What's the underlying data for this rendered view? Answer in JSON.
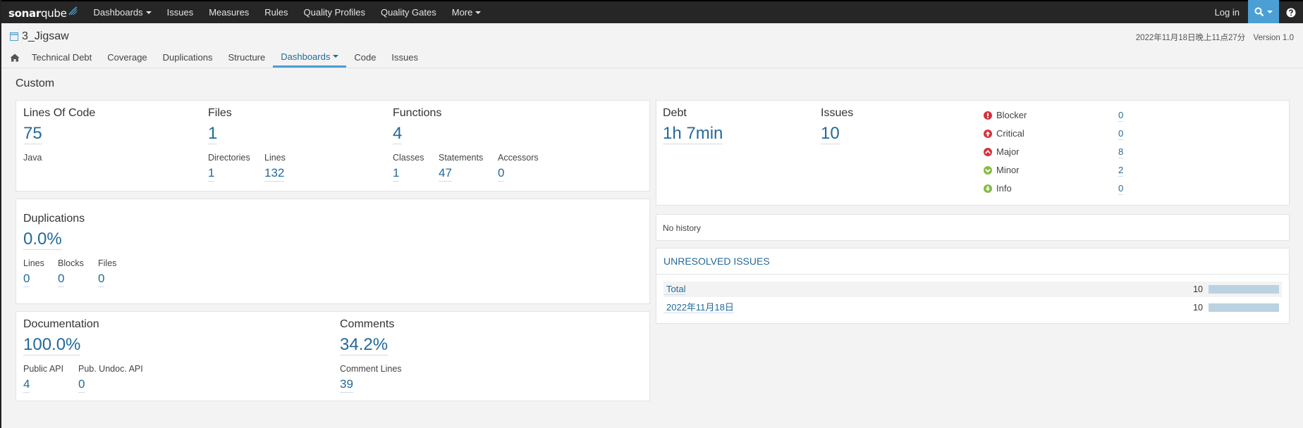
{
  "nav": {
    "logo_bold": "sonar",
    "logo_light": "qube",
    "items": [
      "Dashboards",
      "Issues",
      "Measures",
      "Rules",
      "Quality Profiles",
      "Quality Gates",
      "More"
    ],
    "login": "Log in"
  },
  "project": {
    "name": "3_Jigsaw",
    "date": "2022年11月18日晚上11点27分",
    "version": "Version 1.0"
  },
  "subnav": {
    "items": [
      "Technical Debt",
      "Coverage",
      "Duplications",
      "Structure",
      "Dashboards",
      "Code",
      "Issues"
    ],
    "active": "Dashboards"
  },
  "page_title": "Custom",
  "size": {
    "loc_label": "Lines Of Code",
    "loc_value": "75",
    "language": "Java",
    "files_label": "Files",
    "files_value": "1",
    "directories_label": "Directories",
    "directories_value": "1",
    "lines_label": "Lines",
    "lines_value": "132",
    "functions_label": "Functions",
    "functions_value": "4",
    "classes_label": "Classes",
    "classes_value": "1",
    "statements_label": "Statements",
    "statements_value": "47",
    "accessors_label": "Accessors",
    "accessors_value": "0"
  },
  "duplications": {
    "title": "Duplications",
    "value": "0.0%",
    "lines_label": "Lines",
    "lines_value": "0",
    "blocks_label": "Blocks",
    "blocks_value": "0",
    "files_label": "Files",
    "files_value": "0"
  },
  "documentation": {
    "title": "Documentation",
    "value": "100.0%",
    "public_api_label": "Public API",
    "public_api_value": "4",
    "undoc_label": "Pub. Undoc. API",
    "undoc_value": "0",
    "comments_title": "Comments",
    "comments_value": "34.2%",
    "comment_lines_label": "Comment Lines",
    "comment_lines_value": "39"
  },
  "debt": {
    "debt_label": "Debt",
    "debt_value": "1h 7min",
    "issues_label": "Issues",
    "issues_value": "10",
    "severities": [
      {
        "name": "Blocker",
        "count": "0",
        "color": "#d4333f"
      },
      {
        "name": "Critical",
        "count": "0",
        "color": "#d4333f"
      },
      {
        "name": "Major",
        "count": "8",
        "color": "#d4333f"
      },
      {
        "name": "Minor",
        "count": "2",
        "color": "#85bb43"
      },
      {
        "name": "Info",
        "count": "0",
        "color": "#85bb43"
      }
    ]
  },
  "history": {
    "text": "No history"
  },
  "unresolved": {
    "title": "UNRESOLVED ISSUES",
    "rows": [
      {
        "label": "Total",
        "count": "10",
        "fraction": 1.0
      },
      {
        "label": "2022年11月18日",
        "count": "10",
        "fraction": 1.0
      }
    ]
  },
  "colors": {
    "accent": "#4b9fd5",
    "link": "#236a97",
    "navbar": "#262626"
  }
}
